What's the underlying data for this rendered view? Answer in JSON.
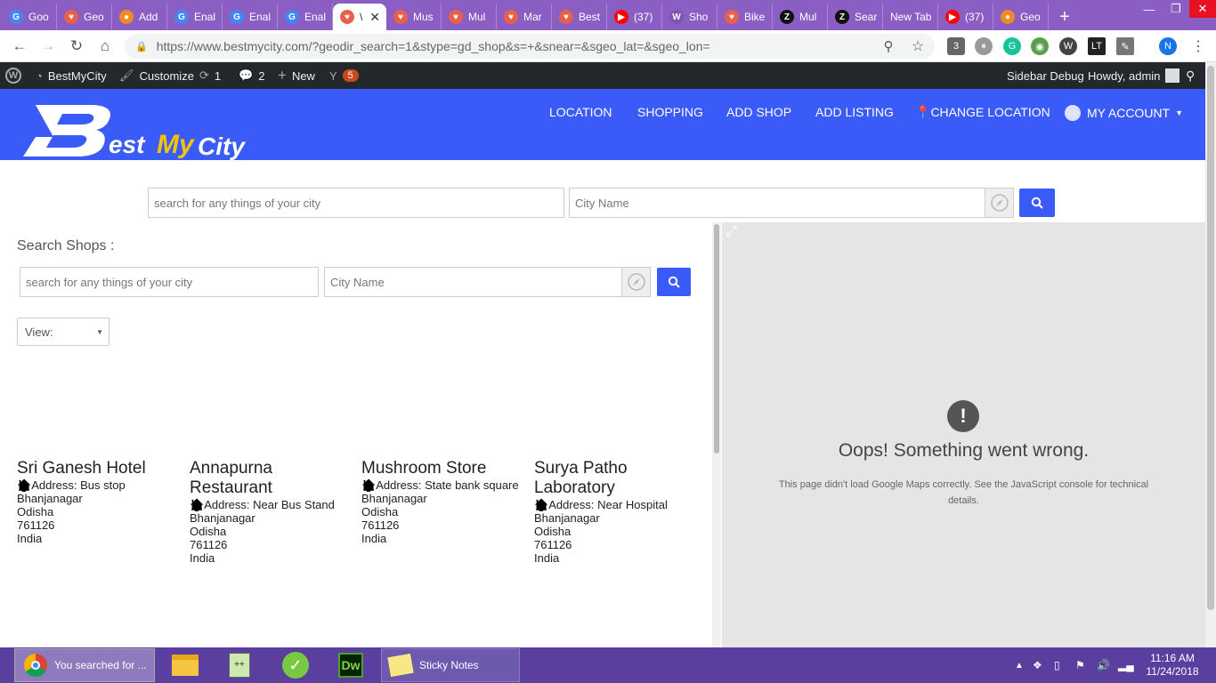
{
  "browser": {
    "tabs": [
      {
        "label": "Goo",
        "fav": "G",
        "color": "#4285f4"
      },
      {
        "label": "Geo",
        "fav": "♥",
        "color": "#e8604c"
      },
      {
        "label": "Add",
        "fav": "●",
        "color": "#f08a24"
      },
      {
        "label": "Enal",
        "fav": "G",
        "color": "#4285f4"
      },
      {
        "label": "Enal",
        "fav": "G",
        "color": "#4285f4"
      },
      {
        "label": "Enal",
        "fav": "G",
        "color": "#4285f4"
      },
      {
        "label": "\\",
        "fav": "♥",
        "color": "#e8604c",
        "active": true
      },
      {
        "label": "Mus",
        "fav": "♥",
        "color": "#e8604c"
      },
      {
        "label": "Mul",
        "fav": "♥",
        "color": "#e8604c"
      },
      {
        "label": "Mar",
        "fav": "♥",
        "color": "#e8604c"
      },
      {
        "label": "Best",
        "fav": "♥",
        "color": "#e8604c"
      },
      {
        "label": "(37)",
        "fav": "▶",
        "color": "#ff0000"
      },
      {
        "label": "Sho",
        "fav": "W",
        "color": "#7f54b3"
      },
      {
        "label": "Bike",
        "fav": "♥",
        "color": "#e8604c"
      },
      {
        "label": "Mul",
        "fav": "Z",
        "color": "#111111"
      },
      {
        "label": "Sear",
        "fav": "Z",
        "color": "#111111"
      },
      {
        "label": "New Tab",
        "fav": "",
        "color": ""
      },
      {
        "label": "(37)",
        "fav": "▶",
        "color": "#ff0000"
      },
      {
        "label": "Geo",
        "fav": "●",
        "color": "#f08a24"
      }
    ],
    "new_tab": "+",
    "url": "https://www.bestmycity.com/?geodir_search=1&stype=gd_shop&s=+&snear=&sgeo_lat=&sgeo_lon=",
    "profile_letter": "N",
    "ext_badge": "3"
  },
  "adminbar": {
    "site": "BestMyCity",
    "customize": "Customize",
    "updates": "1",
    "comments": "2",
    "new": "New",
    "yoast_count": "5",
    "sidebar_debug": "Sidebar Debug",
    "howdy": "Howdy, admin"
  },
  "header": {
    "logo_text": "BestMyCity",
    "menu": [
      "LOCATION",
      "SHOPPING",
      "ADD SHOP",
      "ADD LISTING",
      "CHANGE LOCATION",
      "MY ACCOUNT"
    ]
  },
  "top_search": {
    "query_placeholder": "search for any things of your city",
    "city_placeholder": "City Name"
  },
  "shops": {
    "title": "Search Shops :",
    "query_placeholder": "search for any things of your city",
    "city_placeholder": "City Name",
    "view_label": "View:"
  },
  "listings": [
    {
      "title": "Sri Ganesh Hotel",
      "address": "Address: Bus stop",
      "city": "Bhanjanagar",
      "state": "Odisha",
      "zip": "761126",
      "country": "India"
    },
    {
      "title": "Annapurna Restaurant",
      "address": "Address: Near Bus Stand",
      "city": "Bhanjanagar",
      "state": "Odisha",
      "zip": "761126",
      "country": "India"
    },
    {
      "title": "Mushroom Store",
      "address": "Address: State bank square",
      "city": "Bhanjanagar",
      "state": "Odisha",
      "zip": "761126",
      "country": "India"
    },
    {
      "title": "Surya Patho Laboratory",
      "address": "Address: Near Hospital",
      "city": "Bhanjanagar",
      "state": "Odisha",
      "zip": "761126",
      "country": "India"
    }
  ],
  "map": {
    "error_title": "Oops! Something went wrong.",
    "error_msg": "This page didn't load Google Maps correctly. See the JavaScript console for technical details."
  },
  "taskbar": {
    "chrome_label": "You searched for ...",
    "sticky_label": "Sticky Notes",
    "dw_label": "Dw",
    "time": "11:16 AM",
    "date": "11/24/2018"
  }
}
